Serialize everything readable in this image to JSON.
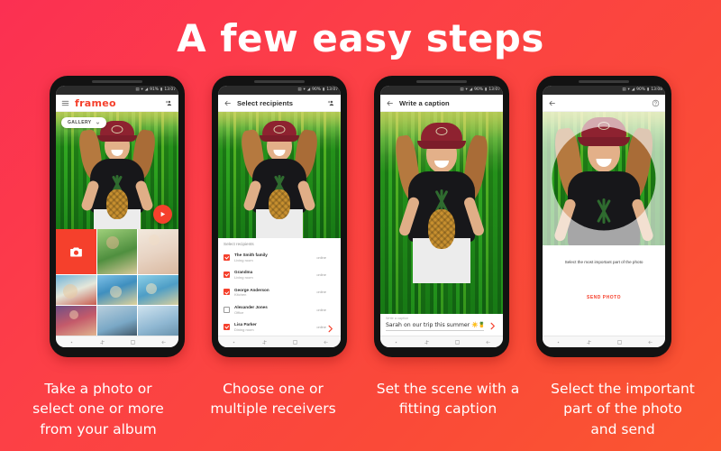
{
  "hero": {
    "title": "A few easy steps"
  },
  "theme": {
    "bg_start": "#fb3052",
    "bg_end": "#fa5630",
    "accent": "#f5402c",
    "phone_body": "#121212"
  },
  "phones": [
    {
      "status": {
        "battery": "91%",
        "time": "13:07"
      },
      "appbar": {
        "logo": "frameo",
        "menu_icon": "hamburger-icon",
        "action_icon": "add-person-icon"
      },
      "gallery_button": {
        "label": "GALLERY",
        "chevron": "chevron-down-icon"
      },
      "fab": {
        "icon": "send-play-icon"
      },
      "grid": {
        "camera_tile_icon": "camera-icon",
        "tiles": [
          "photo-girl-green",
          "photo-girl-confetti",
          "photo-watermelon",
          "photo-beach-drink",
          "photo-friends-party",
          "photo-flowers",
          "photo-landscape",
          "photo-sky"
        ]
      },
      "navbar": [
        "dot-icon",
        "recents-icon",
        "home-icon",
        "back-icon"
      ],
      "caption": "Take a photo or select one or more from your album"
    },
    {
      "status": {
        "battery": "90%",
        "time": "13:07"
      },
      "appbar": {
        "back_icon": "back-arrow-icon",
        "title": "Select recipients",
        "action_icon": "add-person-icon"
      },
      "recipients": {
        "section_label": "Select recipients",
        "arrow_icon": "next-arrow-icon",
        "items": [
          {
            "name": "The Smith family",
            "room": "Living room",
            "status": "online",
            "checked": true
          },
          {
            "name": "Grandma",
            "room": "Living room",
            "status": "online",
            "checked": true
          },
          {
            "name": "George Anderson",
            "room": "Kitchen",
            "status": "online",
            "checked": true
          },
          {
            "name": "Alexander Jones",
            "room": "Office",
            "status": "online",
            "checked": false
          },
          {
            "name": "Lisa Parker",
            "room": "Dining room",
            "status": "online",
            "checked": true
          }
        ]
      },
      "navbar": [
        "dot-icon",
        "recents-icon",
        "home-icon",
        "back-icon"
      ],
      "caption": "Set the scene with a fitting caption"
    },
    {
      "status": {
        "battery": "90%",
        "time": "13:07"
      },
      "appbar": {
        "back_icon": "back-arrow-icon",
        "title": "Write a caption"
      },
      "caption_field": {
        "label": "Write a caption",
        "value": "Sarah on our trip this summer ☀️🍍",
        "submit_icon": "next-arrow-icon"
      },
      "navbar": [
        "dot-icon",
        "recents-icon",
        "home-icon",
        "back-icon"
      ]
    },
    {
      "status": {
        "battery": "90%",
        "time": "13:08"
      },
      "appbar": {
        "back_icon": "back-arrow-icon",
        "help_icon": "help-circle-icon"
      },
      "crop": {
        "message": "Select the most important part of the photo",
        "send_label": "SEND PHOTO"
      },
      "navbar": [
        "dot-icon",
        "recents-icon",
        "home-icon",
        "back-icon"
      ]
    }
  ],
  "captions": [
    "Take a photo or select one or more from your album",
    "Choose one or multiple receivers",
    "Set the scene with a fitting caption",
    "Select the important part of the photo and send"
  ]
}
